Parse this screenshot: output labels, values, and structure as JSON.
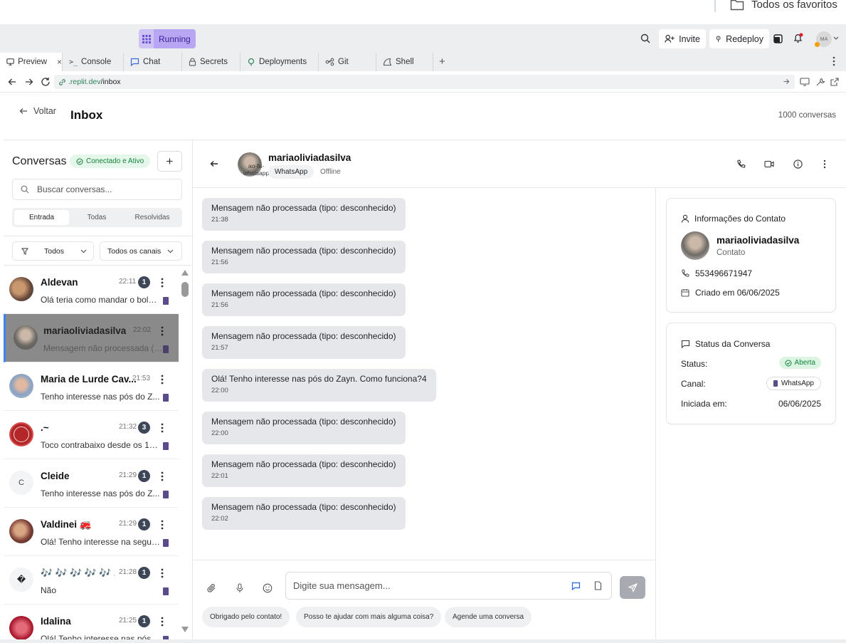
{
  "bookmarks": {
    "folder_label": "Todos os favoritos"
  },
  "topbar": {
    "running_label": "Running",
    "invite_label": "Invite",
    "redeploy_label": "Redeploy",
    "avatar_initials": "MA"
  },
  "tabs": [
    {
      "label": "Preview",
      "icon": "monitor-icon"
    },
    {
      "label": "Console",
      "icon": "terminal-icon"
    },
    {
      "label": "Chat",
      "icon": "chat-icon"
    },
    {
      "label": "Secrets",
      "icon": "lock-icon"
    },
    {
      "label": "Deployments",
      "icon": "deploy-icon"
    },
    {
      "label": "Git",
      "icon": "git-icon"
    },
    {
      "label": "Shell",
      "icon": "shell-icon"
    }
  ],
  "url": {
    "domain": ".replit.dev",
    "path": "/inbox"
  },
  "page": {
    "back_label": "Voltar",
    "title": "Inbox",
    "count": "1000 conversas"
  },
  "sidebar": {
    "title": "Conversas",
    "status_label": "Conectado e Ativo",
    "search_placeholder": "Buscar conversas...",
    "segments": [
      "Entrada",
      "Todas",
      "Resolvidas"
    ],
    "filter_label": "Todos",
    "channel_label": "Todos os canais",
    "conversations": [
      {
        "name": "Aldevan",
        "time": "22:11",
        "badge": "1",
        "preview": "Olá teria como mandar o bole..."
      },
      {
        "name": "mariaoliviadasilva",
        "time": "22:02",
        "badge": "",
        "preview": "Mensagem não processada (t..."
      },
      {
        "name": "Maria de Lurde Cav...",
        "time": "21:53",
        "badge": "",
        "preview": "Tenho interesse nas pós do Z..."
      },
      {
        "name": ".~",
        "time": "21:32",
        "badge": "3",
        "preview": "Toco contrabaixo desde os 13..."
      },
      {
        "name": "Cleide",
        "time": "21:29",
        "badge": "1",
        "preview": "Tenho interesse nas pós do Z...",
        "initial": "C"
      },
      {
        "name": "Valdinei 🚒",
        "time": "21:29",
        "badge": "1",
        "preview": "Olá! Tenho interesse na segun..."
      },
      {
        "name": "🎶 🎶 🎶 🎶 🎶 ...",
        "time": "21:28",
        "badge": "1",
        "preview": "Não",
        "initial": "�"
      },
      {
        "name": "Idalina",
        "time": "21:25",
        "badge": "1",
        "preview": "Olá! Tenho interesse nas pós..."
      }
    ]
  },
  "chat": {
    "contact_name": "mariaoliviadasilva",
    "avatar_alt": "ao-fa-whatsapp",
    "channel": "WhatsApp",
    "presence": "Offline",
    "messages": [
      {
        "text": "Mensagem não processada (tipo: desconhecido)",
        "time": "21:38"
      },
      {
        "text": "Mensagem não processada (tipo: desconhecido)",
        "time": "21:56"
      },
      {
        "text": "Mensagem não processada (tipo: desconhecido)",
        "time": "21:56"
      },
      {
        "text": "Mensagem não processada (tipo: desconhecido)",
        "time": "21:57"
      },
      {
        "text": "Olá! Tenho interesse nas pós do Zayn. Como funciona?4",
        "time": "22:00"
      },
      {
        "text": "Mensagem não processada (tipo: desconhecido)",
        "time": "22:00"
      },
      {
        "text": "Mensagem não processada (tipo: desconhecido)",
        "time": "22:01"
      },
      {
        "text": "Mensagem não processada (tipo: desconhecido)",
        "time": "22:02"
      }
    ],
    "input_placeholder": "Digite sua mensagem...",
    "quick_replies": [
      "Obrigado pelo contato!",
      "Posso te ajudar com mais alguma coisa?",
      "Agende uma conversa"
    ]
  },
  "contact_info": {
    "title": "Informações do Contato",
    "name": "mariaoliviadasilva",
    "role": "Contato",
    "phone": "553496671947",
    "created": "Criado em 06/06/2025"
  },
  "conversation_status": {
    "title": "Status da Conversa",
    "status_label": "Status:",
    "status_value": "Aberta",
    "channel_label": "Canal:",
    "channel_value": "WhatsApp",
    "started_label": "Iniciada em:",
    "started_value": "06/06/2025"
  },
  "colors": {
    "accent_green": "#16a34a",
    "badge_bg": "#3d4757",
    "bubble_bg": "#e6e7ea",
    "running_bg": "#b9a6f3",
    "selected_row": "#8a8a8a"
  }
}
